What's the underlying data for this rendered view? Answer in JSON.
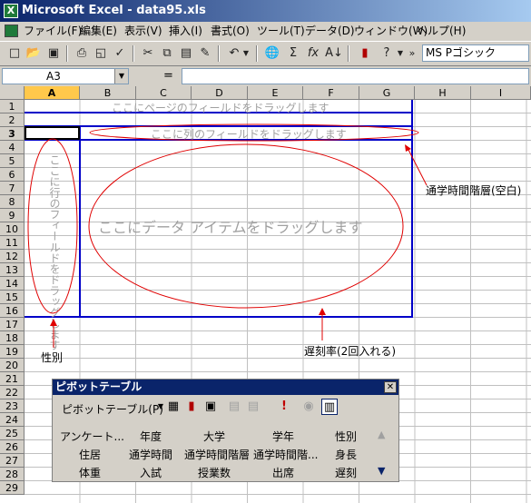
{
  "window": {
    "title": "Microsoft Excel - data95.xls",
    "logo_letter": "X"
  },
  "menu": [
    "ファイル(F)",
    "編集(E)",
    "表示(V)",
    "挿入(I)",
    "書式(O)",
    "ツール(T)",
    "データ(D)",
    "ウィンドウ(W)",
    "ヘルプ(H)"
  ],
  "toolbar": {
    "font_name": "MS Pゴシック"
  },
  "formula": {
    "name_box": "A3",
    "eq": "=",
    "value": ""
  },
  "sheet": {
    "columns": [
      "A",
      "B",
      "C",
      "D",
      "E",
      "F",
      "G",
      "H",
      "I"
    ],
    "rows": [
      "1",
      "2",
      "3",
      "4",
      "5",
      "6",
      "7",
      "8",
      "9",
      "10",
      "11",
      "12",
      "13",
      "14",
      "15",
      "16",
      "17",
      "18",
      "19",
      "20",
      "21",
      "22",
      "23",
      "24",
      "25",
      "26",
      "27",
      "28",
      "29"
    ]
  },
  "pivot_area": {
    "page_drop": "ここにページのフィールドをドラッグします",
    "col_drop": "ここに列のフィールドをドラッグします",
    "row_drop": "ここに行のフィールドをドラッグします",
    "data_drop": "ここにデータ アイテムをドラッグします"
  },
  "annotations": {
    "col_note": "通学時間階層(空白)",
    "row_note": "性別",
    "data_note": "遅刻率(2回入れる)"
  },
  "pivot_toolbar": {
    "title": "ピボットテーブル",
    "menu_label": "ピボットテーブル(P)",
    "fields": [
      [
        "アンケート...",
        "年度",
        "大学",
        "学年",
        "性別"
      ],
      [
        "住居",
        "通学時間",
        "通学時間階層",
        "通学時間階...",
        "身長"
      ],
      [
        "体重",
        "入試",
        "授業数",
        "出席",
        "遅刻"
      ]
    ]
  }
}
